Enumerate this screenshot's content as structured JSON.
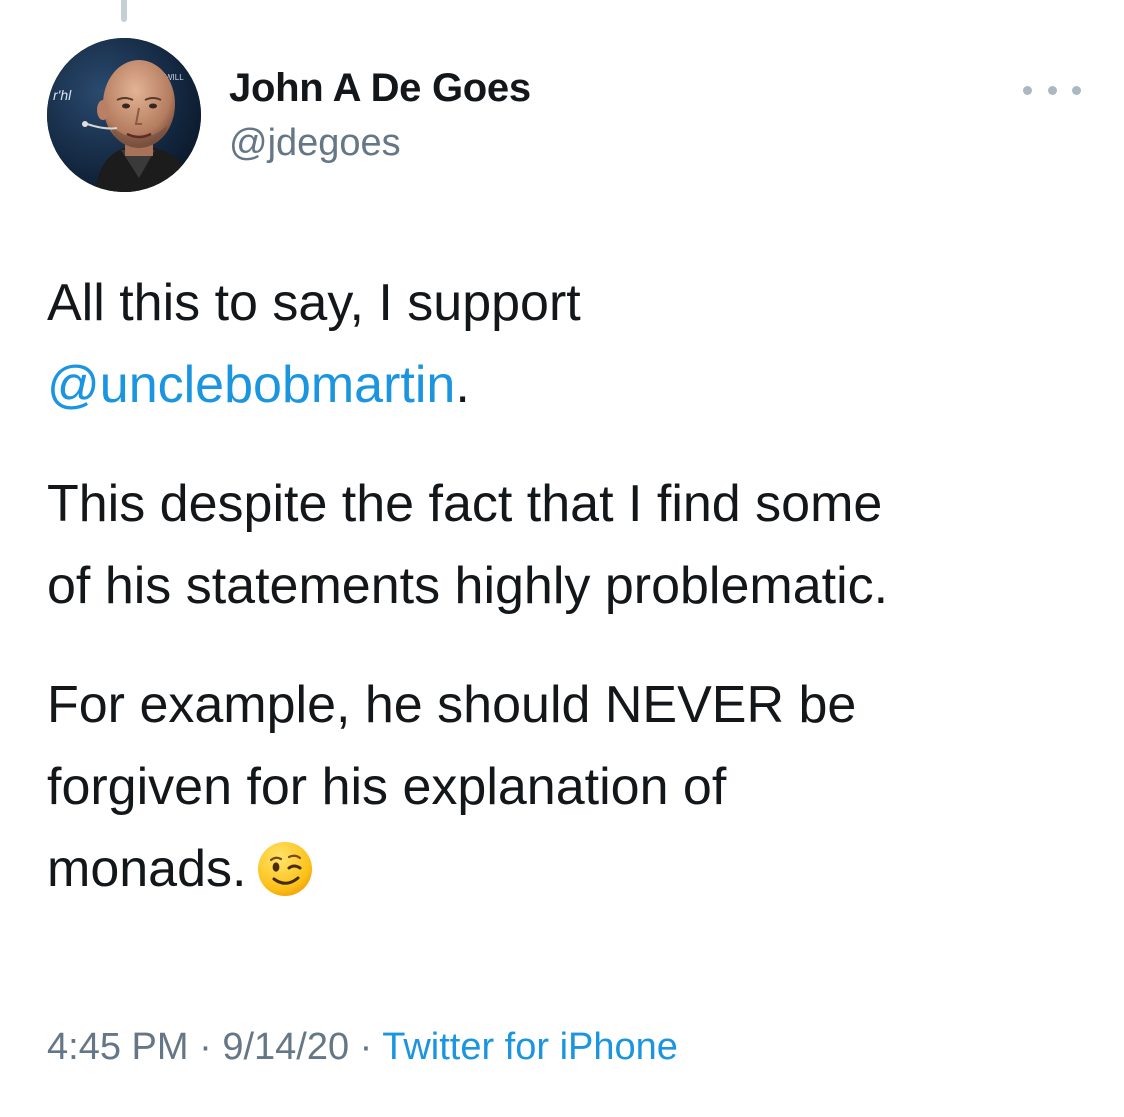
{
  "author": {
    "name": "John A De Goes",
    "handle": "@jdegoes"
  },
  "more_icon": "more-horizontal-icon",
  "tweet": {
    "p1_line1": "All this to say, I support",
    "p1_mention": "@unclebobmartin",
    "p1_after": ".",
    "p2_line1": "This despite the fact that I find some",
    "p2_line2": "of his statements highly problematic.",
    "p3_line1": "For example, he should NEVER be",
    "p3_line2": "forgiven for his explanation of",
    "p3_line3": "monads.",
    "emoji": "winking-face-icon"
  },
  "meta": {
    "time": "4:45 PM",
    "sep1": " · ",
    "date": "9/14/20",
    "sep2": " · ",
    "source": "Twitter for iPhone"
  },
  "colors": {
    "text": "#14171a",
    "secondary": "#657786",
    "link": "#1b95e0",
    "thread_line": "#c4cfd6"
  }
}
